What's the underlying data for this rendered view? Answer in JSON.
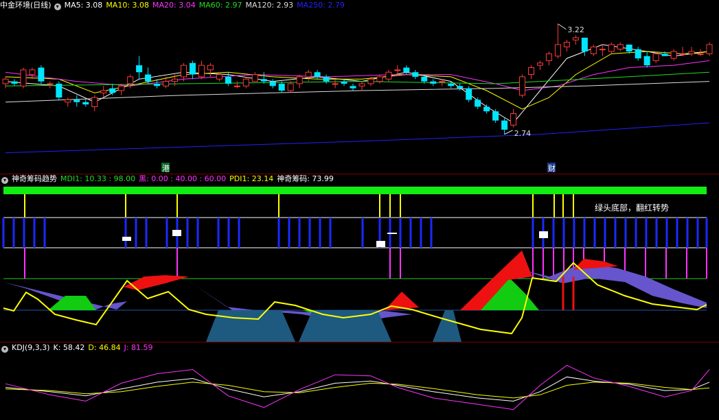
{
  "colors": {
    "bg": "#000000",
    "up": "#ff3b3b",
    "down": "#00e5ff",
    "grid": "#7a0000"
  },
  "panels": {
    "main": {
      "title": "中金环境(日线)",
      "indicators": [
        {
          "label": "MA5: 3.08",
          "color": "#ffffff"
        },
        {
          "label": "MA10: 3.08",
          "color": "#ffff00"
        },
        {
          "label": "MA20: 3.04",
          "color": "#ff33ff"
        },
        {
          "label": "MA60: 2.97",
          "color": "#22dd22"
        },
        {
          "label": "MA120: 2.93",
          "color": "#dddddd"
        },
        {
          "label": "MA250: 2.79",
          "color": "#2222ff"
        }
      ],
      "high_label": "3.22",
      "low_label": "2.74",
      "marker1": "港",
      "marker2": "财",
      "collapse_icon": "chevron-down-icon"
    },
    "indicator": {
      "title": "神奇筹码趋势",
      "indicators": [
        {
          "label": "MDI1: 10.33 : 98.00",
          "color": "#22dd22"
        },
        {
          "label": "黑: 0.00 : 40.00 : 60.00",
          "color": "#ff33ff"
        },
        {
          "label": "PDI1: 23.14",
          "color": "#ffff00"
        },
        {
          "label": "神奇筹码: 73.99",
          "color": "#ffffff"
        }
      ],
      "annotation": "绿头底部，翻红转势",
      "collapse_icon": "chevron-down-icon"
    },
    "kdj": {
      "title": "KDJ(9,3,3)",
      "indicators": [
        {
          "label": "K: 58.42",
          "color": "#ffffff"
        },
        {
          "label": "D: 46.84",
          "color": "#ffff00"
        },
        {
          "label": "J: 81.59",
          "color": "#ff33ff"
        }
      ],
      "collapse_icon": "chevron-down-icon"
    }
  },
  "chart_data": {
    "type": "candlestick",
    "title": "中金环境(日线)",
    "ylim": [
      2.62,
      3.27
    ],
    "candles": [
      [
        2.96,
        2.99,
        2.94,
        2.98
      ],
      [
        2.97,
        2.98,
        2.95,
        2.96
      ],
      [
        2.95,
        3.03,
        2.94,
        3.02
      ],
      [
        3.0,
        3.03,
        2.98,
        3.02
      ],
      [
        3.03,
        3.04,
        2.96,
        2.97
      ],
      [
        2.96,
        2.97,
        2.94,
        2.96
      ],
      [
        2.96,
        2.97,
        2.89,
        2.9
      ],
      [
        2.88,
        2.9,
        2.86,
        2.89
      ],
      [
        2.89,
        2.91,
        2.86,
        2.88
      ],
      [
        2.88,
        2.89,
        2.86,
        2.87
      ],
      [
        2.86,
        2.91,
        2.84,
        2.9
      ],
      [
        2.92,
        2.95,
        2.9,
        2.93
      ],
      [
        2.94,
        2.96,
        2.91,
        2.92
      ],
      [
        2.93,
        2.96,
        2.91,
        2.95
      ],
      [
        2.96,
        3.0,
        2.94,
        2.99
      ],
      [
        3.04,
        3.08,
        2.98,
        3.01
      ],
      [
        3.0,
        3.03,
        2.96,
        2.97
      ],
      [
        2.96,
        2.98,
        2.94,
        2.95
      ],
      [
        2.95,
        2.99,
        2.94,
        2.97
      ],
      [
        2.97,
        3.0,
        2.95,
        2.98
      ],
      [
        2.99,
        3.05,
        2.97,
        3.04
      ],
      [
        3.05,
        3.06,
        2.98,
        3.0
      ],
      [
        2.99,
        3.06,
        2.98,
        3.04
      ],
      [
        3.02,
        3.05,
        2.99,
        3.04
      ],
      [
        2.98,
        3.01,
        2.97,
        3.0
      ],
      [
        2.99,
        3.01,
        2.95,
        2.96
      ],
      [
        2.95,
        2.97,
        2.94,
        2.95
      ],
      [
        2.95,
        2.99,
        2.94,
        2.98
      ],
      [
        2.97,
        3.01,
        2.97,
        3.0
      ],
      [
        2.98,
        3.01,
        2.96,
        2.97
      ],
      [
        2.97,
        2.98,
        2.94,
        2.95
      ],
      [
        2.96,
        2.97,
        2.92,
        2.93
      ],
      [
        2.93,
        2.97,
        2.92,
        2.96
      ],
      [
        2.96,
        3.0,
        2.94,
        2.99
      ],
      [
        2.99,
        3.02,
        2.97,
        3.01
      ],
      [
        3.01,
        3.02,
        2.98,
        2.99
      ],
      [
        2.99,
        3.0,
        2.96,
        2.97
      ],
      [
        2.96,
        2.98,
        2.94,
        2.96
      ],
      [
        2.97,
        2.98,
        2.95,
        2.96
      ],
      [
        2.95,
        2.96,
        2.93,
        2.94
      ],
      [
        2.95,
        2.97,
        2.93,
        2.96
      ],
      [
        2.96,
        2.99,
        2.95,
        2.98
      ],
      [
        2.97,
        3.0,
        2.96,
        2.99
      ],
      [
        2.98,
        3.02,
        2.97,
        3.01
      ],
      [
        3.02,
        3.04,
        3.0,
        3.02
      ],
      [
        3.03,
        3.04,
        3.0,
        3.01
      ],
      [
        3.01,
        3.02,
        2.98,
        2.99
      ],
      [
        2.99,
        3.0,
        2.96,
        2.97
      ],
      [
        2.97,
        2.98,
        2.95,
        2.96
      ],
      [
        2.97,
        2.98,
        2.95,
        2.97
      ],
      [
        2.96,
        2.97,
        2.94,
        2.95
      ],
      [
        2.95,
        2.96,
        2.93,
        2.94
      ],
      [
        2.94,
        2.95,
        2.88,
        2.89
      ],
      [
        2.89,
        2.9,
        2.85,
        2.86
      ],
      [
        2.86,
        2.87,
        2.83,
        2.84
      ],
      [
        2.84,
        2.85,
        2.79,
        2.8
      ],
      [
        2.8,
        2.81,
        2.74,
        2.76
      ],
      [
        2.78,
        2.85,
        2.77,
        2.83
      ],
      [
        2.91,
        3.0,
        2.9,
        2.99
      ],
      [
        3.0,
        3.04,
        2.98,
        3.03
      ],
      [
        3.04,
        3.06,
        3.02,
        3.05
      ],
      [
        3.06,
        3.1,
        3.04,
        3.09
      ],
      [
        3.08,
        3.22,
        3.07,
        3.13
      ],
      [
        3.12,
        3.15,
        3.1,
        3.14
      ],
      [
        3.15,
        3.17,
        3.13,
        3.16
      ],
      [
        3.16,
        3.16,
        3.08,
        3.1
      ],
      [
        3.09,
        3.13,
        3.08,
        3.12
      ],
      [
        3.11,
        3.13,
        3.08,
        3.11
      ],
      [
        3.1,
        3.14,
        3.09,
        3.13
      ],
      [
        3.11,
        3.14,
        3.1,
        3.13
      ],
      [
        3.13,
        3.13,
        3.09,
        3.1
      ],
      [
        3.11,
        3.12,
        3.06,
        3.07
      ],
      [
        3.08,
        3.1,
        3.03,
        3.04
      ],
      [
        3.06,
        3.1,
        3.05,
        3.09
      ],
      [
        3.09,
        3.1,
        3.08,
        3.08
      ],
      [
        3.07,
        3.11,
        3.06,
        3.1
      ],
      [
        3.09,
        3.12,
        3.08,
        3.09
      ],
      [
        3.09,
        3.12,
        3.08,
        3.1
      ],
      [
        3.09,
        3.11,
        3.08,
        3.09
      ],
      [
        3.09,
        3.14,
        3.08,
        3.13
      ]
    ],
    "ma": {
      "MA5": [
        [
          0,
          2.97
        ],
        [
          6,
          2.95
        ],
        [
          10,
          2.88
        ],
        [
          15,
          2.98
        ],
        [
          20,
          3.01
        ],
        [
          25,
          3.0
        ],
        [
          30,
          2.97
        ],
        [
          35,
          2.99
        ],
        [
          40,
          2.97
        ],
        [
          45,
          3.01
        ],
        [
          50,
          2.97
        ],
        [
          54,
          2.86
        ],
        [
          57,
          2.79
        ],
        [
          60,
          2.93
        ],
        [
          63,
          3.07
        ],
        [
          67,
          3.13
        ],
        [
          72,
          3.1
        ],
        [
          75,
          3.08
        ],
        [
          79,
          3.1
        ]
      ],
      "MA10": [
        [
          0,
          2.99
        ],
        [
          6,
          2.98
        ],
        [
          10,
          2.92
        ],
        [
          15,
          2.96
        ],
        [
          20,
          3.0
        ],
        [
          25,
          3.01
        ],
        [
          30,
          2.99
        ],
        [
          35,
          2.98
        ],
        [
          40,
          2.98
        ],
        [
          45,
          3.0
        ],
        [
          50,
          2.99
        ],
        [
          54,
          2.93
        ],
        [
          58,
          2.85
        ],
        [
          61,
          2.9
        ],
        [
          64,
          3.0
        ],
        [
          68,
          3.09
        ],
        [
          72,
          3.1
        ],
        [
          76,
          3.09
        ],
        [
          79,
          3.1
        ]
      ],
      "MA20": [
        [
          0,
          3.01
        ],
        [
          8,
          2.97
        ],
        [
          14,
          2.95
        ],
        [
          20,
          2.98
        ],
        [
          28,
          3.0
        ],
        [
          36,
          2.99
        ],
        [
          44,
          3.0
        ],
        [
          50,
          3.0
        ],
        [
          55,
          2.96
        ],
        [
          58,
          2.93
        ],
        [
          62,
          2.95
        ],
        [
          66,
          3.0
        ],
        [
          70,
          3.03
        ],
        [
          75,
          3.04
        ],
        [
          79,
          3.06
        ]
      ],
      "MA60": [
        [
          0,
          2.95
        ],
        [
          20,
          2.96
        ],
        [
          40,
          2.97
        ],
        [
          55,
          2.96
        ],
        [
          65,
          2.98
        ],
        [
          79,
          3.01
        ]
      ],
      "MA120": [
        [
          0,
          2.88
        ],
        [
          20,
          2.91
        ],
        [
          40,
          2.93
        ],
        [
          55,
          2.94
        ],
        [
          65,
          2.95
        ],
        [
          79,
          2.97
        ]
      ],
      "MA250": [
        [
          0,
          2.66
        ],
        [
          40,
          2.71
        ],
        [
          60,
          2.74
        ],
        [
          79,
          2.79
        ]
      ]
    },
    "kdj": {
      "ylim": [
        -10,
        110
      ],
      "K": [
        [
          0,
          48
        ],
        [
          5,
          40
        ],
        [
          9,
          32
        ],
        [
          13,
          45
        ],
        [
          17,
          58
        ],
        [
          21,
          65
        ],
        [
          25,
          45
        ],
        [
          29,
          30
        ],
        [
          33,
          40
        ],
        [
          37,
          56
        ],
        [
          41,
          60
        ],
        [
          44,
          52
        ],
        [
          48,
          40
        ],
        [
          53,
          28
        ],
        [
          57,
          22
        ],
        [
          60,
          40
        ],
        [
          63,
          68
        ],
        [
          66,
          60
        ],
        [
          70,
          54
        ],
        [
          74,
          42
        ],
        [
          77,
          44
        ],
        [
          79,
          58
        ]
      ],
      "D": [
        [
          0,
          45
        ],
        [
          5,
          42
        ],
        [
          9,
          36
        ],
        [
          13,
          40
        ],
        [
          17,
          50
        ],
        [
          21,
          58
        ],
        [
          25,
          52
        ],
        [
          29,
          40
        ],
        [
          33,
          38
        ],
        [
          37,
          48
        ],
        [
          41,
          56
        ],
        [
          44,
          54
        ],
        [
          48,
          46
        ],
        [
          53,
          34
        ],
        [
          57,
          28
        ],
        [
          60,
          34
        ],
        [
          63,
          52
        ],
        [
          66,
          58
        ],
        [
          70,
          56
        ],
        [
          74,
          48
        ],
        [
          77,
          44
        ],
        [
          79,
          47
        ]
      ],
      "J": [
        [
          0,
          55
        ],
        [
          5,
          34
        ],
        [
          9,
          22
        ],
        [
          13,
          56
        ],
        [
          17,
          74
        ],
        [
          21,
          82
        ],
        [
          25,
          32
        ],
        [
          29,
          10
        ],
        [
          33,
          44
        ],
        [
          37,
          72
        ],
        [
          41,
          70
        ],
        [
          44,
          48
        ],
        [
          48,
          28
        ],
        [
          53,
          16
        ],
        [
          57,
          6
        ],
        [
          60,
          52
        ],
        [
          63,
          90
        ],
        [
          66,
          66
        ],
        [
          70,
          50
        ],
        [
          74,
          30
        ],
        [
          77,
          42
        ],
        [
          79,
          82
        ]
      ]
    }
  }
}
